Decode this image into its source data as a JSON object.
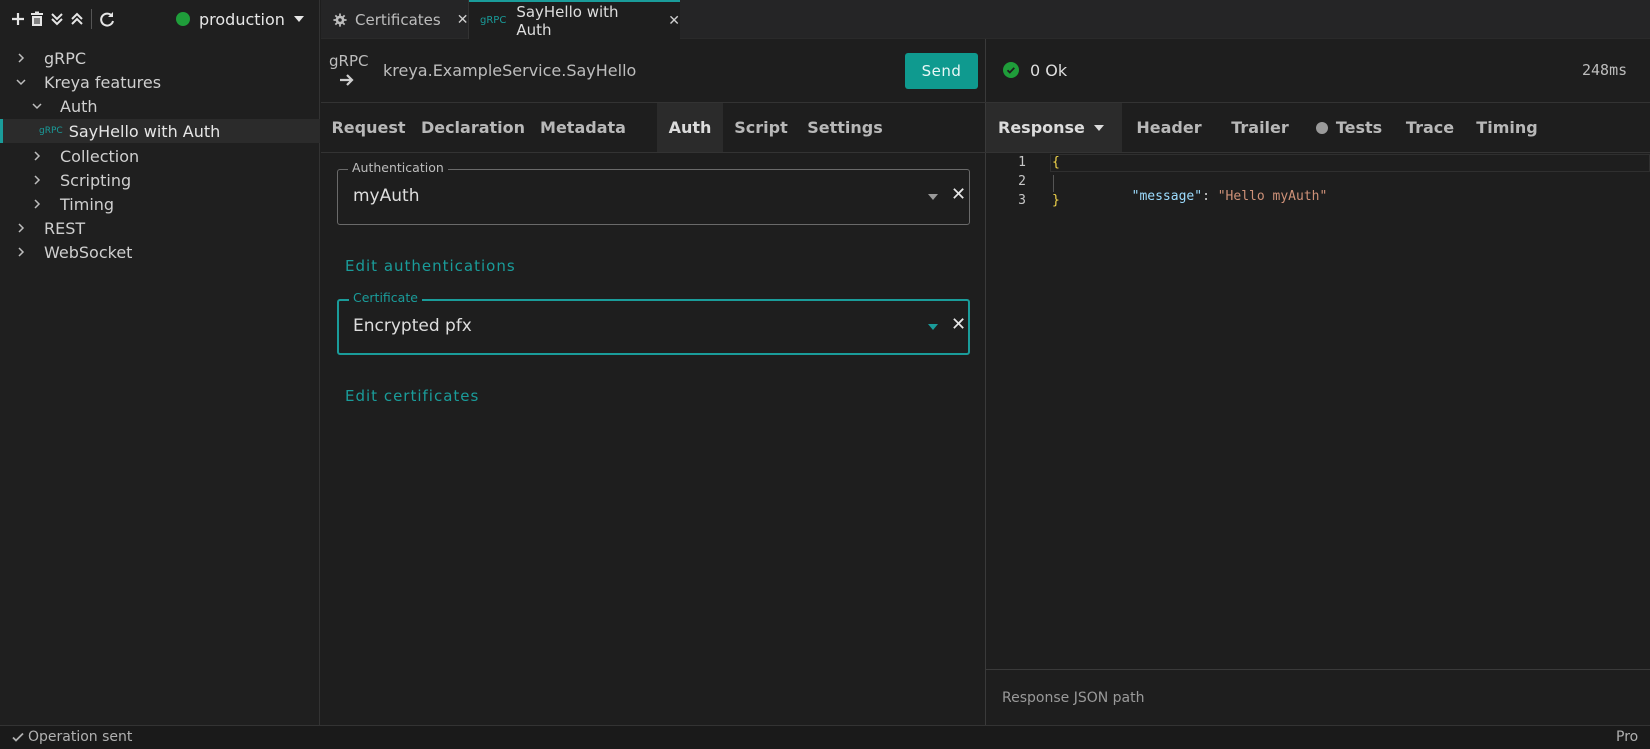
{
  "environment": {
    "name": "production",
    "status_color": "#1f9d3a"
  },
  "toolbar": {
    "icons": [
      "plus-icon",
      "trash-icon",
      "collapse-all-icon",
      "expand-all-icon",
      "refresh-icon"
    ]
  },
  "tree": {
    "grpc": "gRPC",
    "kreya_features": "Kreya features",
    "auth": "Auth",
    "sayhello_tag": "gRPC",
    "sayhello": "SayHello with Auth",
    "collection": "Collection",
    "scripting": "Scripting",
    "timing": "Timing",
    "rest": "REST",
    "websocket": "WebSocket"
  },
  "tabs": [
    {
      "label": "Certificates",
      "icon": "gear-icon"
    },
    {
      "tag": "gRPC",
      "label": "SayHello with Auth"
    }
  ],
  "request": {
    "type": "gRPC",
    "method": "kreya.ExampleService.SayHello",
    "send_label": "Send",
    "tabs": [
      "Request",
      "Declaration",
      "Metadata",
      "Auth",
      "Script",
      "Settings"
    ],
    "active_tab": "Auth",
    "authentication": {
      "label": "Authentication",
      "value": "myAuth"
    },
    "edit_authentications": "Edit authentications",
    "certificate": {
      "label": "Certificate",
      "value": "Encrypted pfx"
    },
    "edit_certificates": "Edit certificates"
  },
  "response": {
    "status": "0 Ok",
    "duration": "248ms",
    "tabs": [
      "Response",
      "Header",
      "Trailer",
      "Tests",
      "Trace",
      "Timing"
    ],
    "active_tab": "Response",
    "code": {
      "line_numbers": [
        "1",
        "2",
        "3"
      ],
      "open_brace": "{",
      "key": "\"message\"",
      "colon": ": ",
      "value": "\"Hello myAuth\"",
      "close_brace": "}"
    },
    "json_path_placeholder": "Response JSON path"
  },
  "statusbar": {
    "message": "Operation sent",
    "plan": "Pro"
  },
  "colors": {
    "accent": "#1a9c9a",
    "ok": "#1f9d3a",
    "brace": "#f2d54b",
    "json_key": "#9cdcfe",
    "json_string": "#ce9178"
  }
}
